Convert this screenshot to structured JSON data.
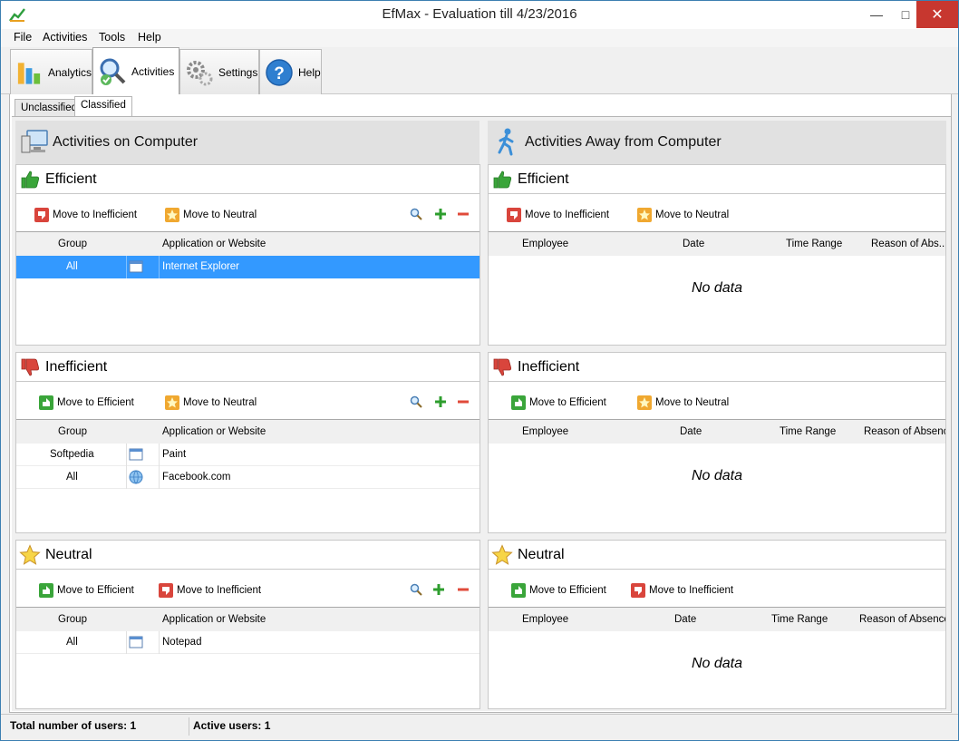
{
  "window": {
    "title": "EfMax - Evaluation till 4/23/2016"
  },
  "menu": [
    "File",
    "Activities",
    "Tools",
    "Help"
  ],
  "toolbar": {
    "analytics": "Analytics",
    "activities": "Activities",
    "settings": "Settings",
    "help": "Help"
  },
  "subtabs": {
    "unclassified": "Unclassified",
    "classified": "Classified"
  },
  "columns": {
    "computer": "Activities on Computer",
    "away": "Activities Away from Computer"
  },
  "sections": {
    "efficient": "Efficient",
    "inefficient": "Inefficient",
    "neutral": "Neutral"
  },
  "actions": {
    "move_to_efficient": "Move to Efficient",
    "move_to_inefficient": "Move to Inefficient",
    "move_to_neutral": "Move to Neutral"
  },
  "grid_headers": {
    "group": "Group",
    "app": "Application or Website",
    "employee": "Employee",
    "date": "Date",
    "time_range": "Time Range",
    "reason_trunc": "Reason of Abs...",
    "reason": "Reason of Absence"
  },
  "computer_efficient_rows": [
    {
      "group": "All",
      "app": "Internet Explorer",
      "icon": "window-icon",
      "selected": true
    }
  ],
  "computer_inefficient_rows": [
    {
      "group": "Softpedia",
      "app": "Paint",
      "icon": "window-icon"
    },
    {
      "group": "All",
      "app": "Facebook.com",
      "icon": "globe-icon"
    }
  ],
  "computer_neutral_rows": [
    {
      "group": "All",
      "app": "Notepad",
      "icon": "window-icon"
    }
  ],
  "no_data": "No data",
  "status": {
    "total_users_label": "Total number of users: 1",
    "active_users_label": "Active users: 1"
  },
  "colors": {
    "selection": "#3399ff",
    "close": "#c7372f",
    "efficient": "#3aa53a",
    "inefficient": "#d9453c",
    "neutral": "#f4c430"
  }
}
